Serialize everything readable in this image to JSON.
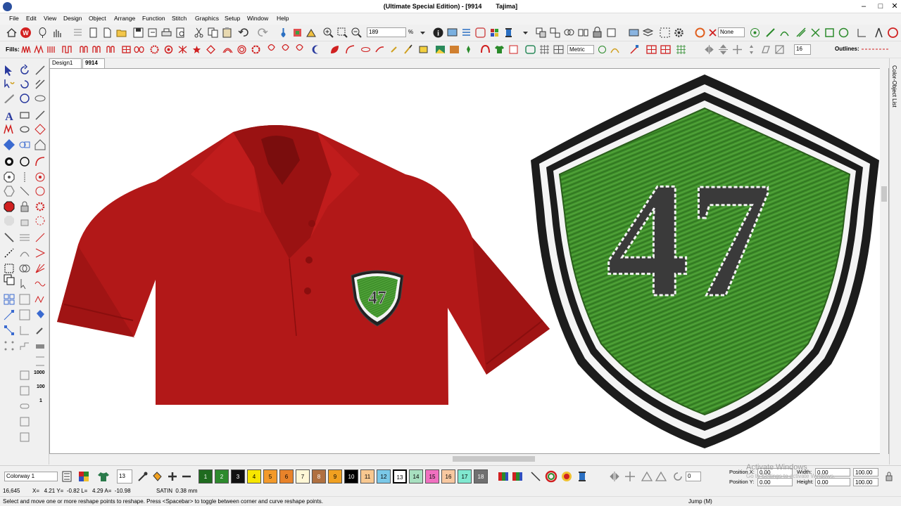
{
  "window": {
    "title": "(Ultimate Special Edition) - [9914        Tajima]",
    "minimize": "–",
    "maximize": "□",
    "close": "✕"
  },
  "menu": [
    "File",
    "Edit",
    "View",
    "Design",
    "Object",
    "Arrange",
    "Function",
    "Stitch",
    "Graphics",
    "Setup",
    "Window",
    "Help"
  ],
  "toolbar1": {
    "zoom_value": "189",
    "zoom_unit": "%",
    "colorway_none": "None"
  },
  "toolbar2": {
    "fills_label": "Fills:",
    "units_value": "Metric",
    "stitch_value": "16",
    "outlines_label": "Outlines:"
  },
  "tabs": [
    "Design1",
    "9914"
  ],
  "tab_close": "✕",
  "right_panel_label": "Color-Object List",
  "left_tools_numbers": [
    "1000",
    "100",
    "1"
  ],
  "bottom": {
    "colorway": "Colorway 1",
    "thread_count": "13",
    "swatches": [
      {
        "label": "1",
        "color": "#1f6b1f",
        "text": "#fff"
      },
      {
        "label": "2",
        "color": "#2d8a2d",
        "text": "#fff"
      },
      {
        "label": "3",
        "color": "#111111",
        "text": "#fff"
      },
      {
        "label": "4",
        "color": "#f7e600",
        "text": "#000"
      },
      {
        "label": "5",
        "color": "#f39a2b",
        "text": "#000"
      },
      {
        "label": "6",
        "color": "#e8832a",
        "text": "#000"
      },
      {
        "label": "7",
        "color": "#fff7d6",
        "text": "#000"
      },
      {
        "label": "8",
        "color": "#b07040",
        "text": "#fff"
      },
      {
        "label": "9",
        "color": "#f0a020",
        "text": "#000"
      },
      {
        "label": "10",
        "color": "#000000",
        "text": "#fff"
      },
      {
        "label": "11",
        "color": "#f8c890",
        "text": "#000"
      },
      {
        "label": "12",
        "color": "#7ac8e8",
        "text": "#000"
      },
      {
        "label": "13",
        "color": "#ffffff",
        "text": "#000"
      },
      {
        "label": "14",
        "color": "#a8e0c0",
        "text": "#000"
      },
      {
        "label": "15",
        "color": "#f070c0",
        "text": "#000"
      },
      {
        "label": "16",
        "color": "#f8c8a0",
        "text": "#000"
      },
      {
        "label": "17",
        "color": "#80e8d0",
        "text": "#000"
      },
      {
        "label": "18",
        "color": "#707070",
        "text": "#fff"
      }
    ],
    "position_x_label": "Position X:",
    "position_y_label": "Position Y:",
    "position_x": "0.00",
    "position_y": "0.00",
    "size_x": "0.00",
    "size_y": "0.00",
    "width_label": "Width:",
    "height_label": "Height:",
    "width": "0.00",
    "height": "0.00",
    "width_pct": "100.00",
    "height_pct": "100.00",
    "lock_value": "0",
    "watermark_line1": "Activate Windows",
    "watermark_line2": "Go to Settings to activate Windows."
  },
  "status": {
    "stitches": "16,645",
    "coords": "X=   4.21 Y=  -0.82 L=   4.29 A=  -10.98",
    "stitch_type": "SATIN  0.38 mm",
    "hint": "Select and move one or more reshape points to reshape. Press <Spacebar> to toggle between corner and curve reshape points.",
    "jump": "Jump (M)"
  },
  "design": {
    "badge_text": "47",
    "shirt_color": "#b21818",
    "badge_green": "#3f8f2b"
  }
}
